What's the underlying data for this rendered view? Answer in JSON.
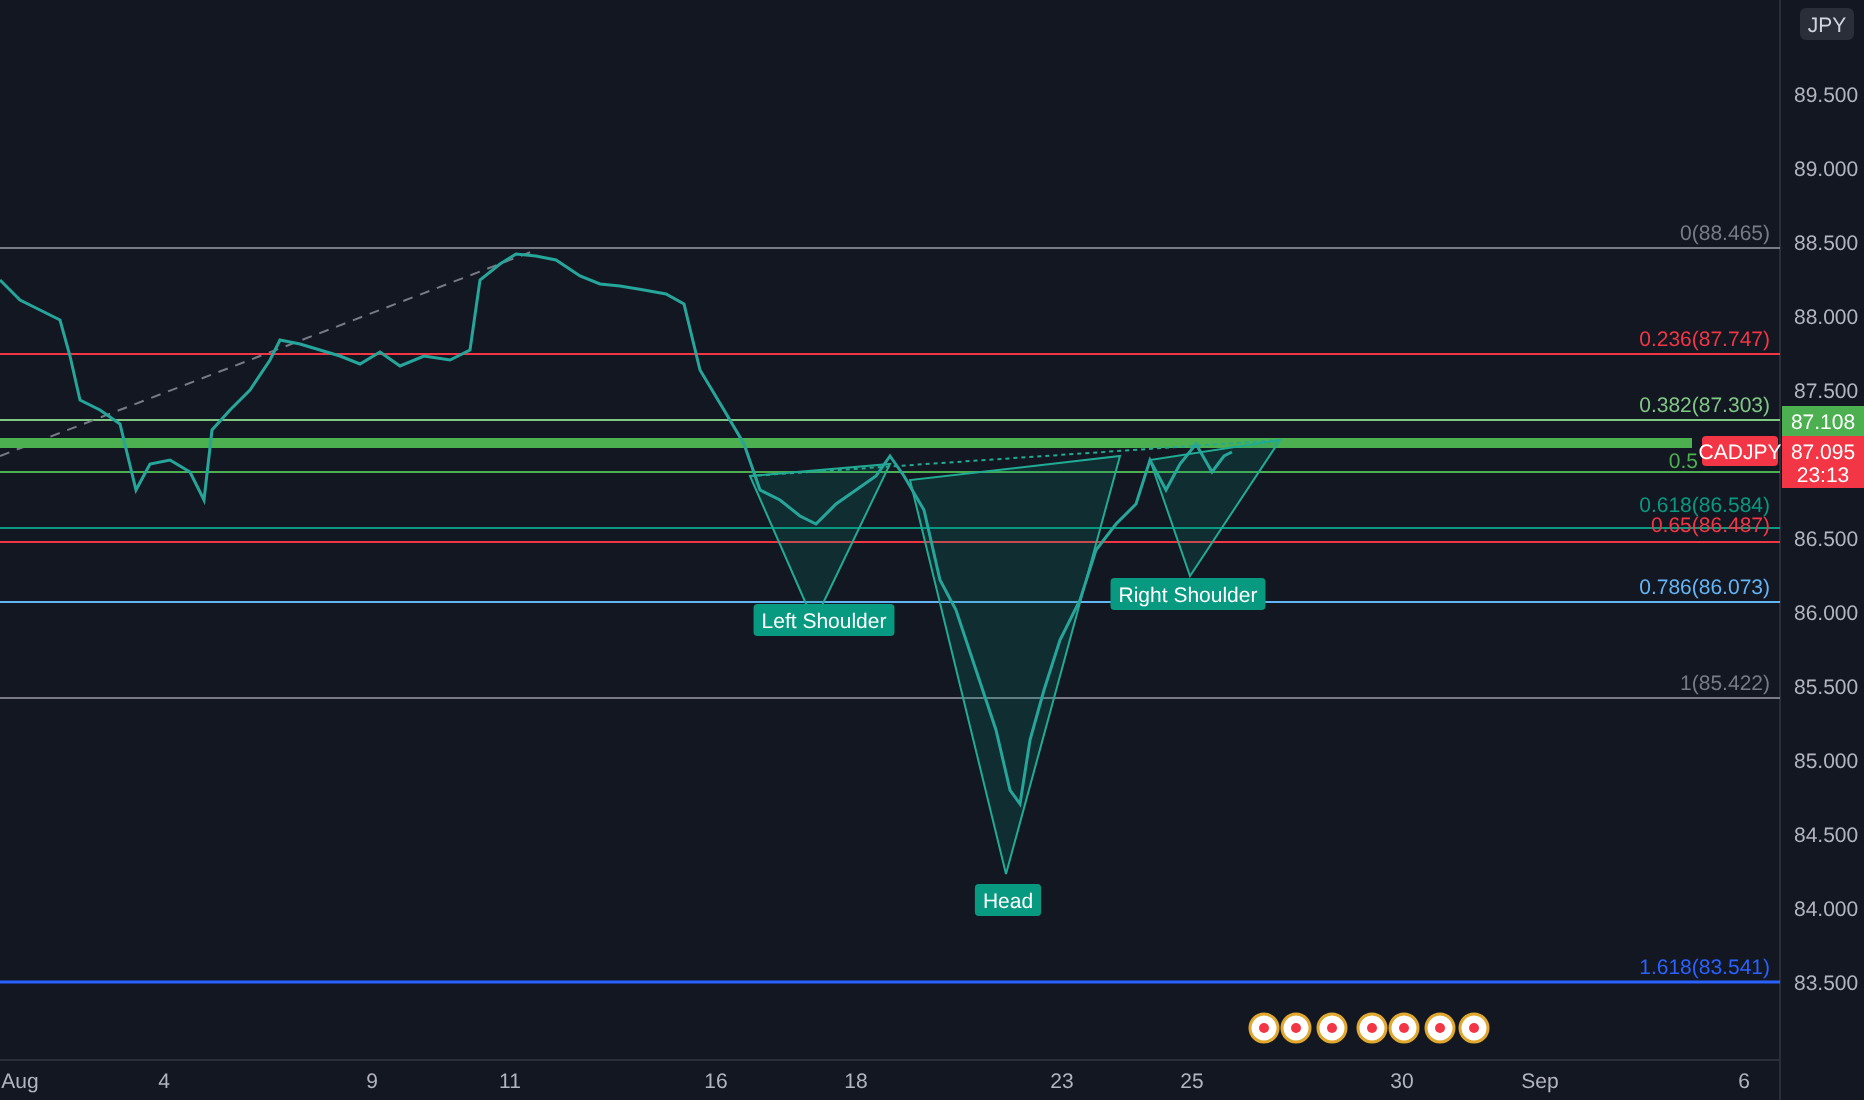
{
  "symbol_badge": "JPY",
  "price_axis": [
    "89.500",
    "89.000",
    "88.500",
    "88.000",
    "87.500",
    "86.500",
    "86.000",
    "85.500",
    "85.000",
    "84.500",
    "84.000",
    "83.500"
  ],
  "time_axis": [
    "Aug",
    "4",
    "9",
    "11",
    "16",
    "18",
    "23",
    "25",
    "30",
    "Sep",
    "6"
  ],
  "fib_levels": [
    {
      "label": "0(88.465)",
      "color": "#787b86"
    },
    {
      "label": "0.236(87.747)",
      "color": "#f23645"
    },
    {
      "label": "0.382(87.303)",
      "color": "#81c784"
    },
    {
      "label": "0.5",
      "color": "#4caf50"
    },
    {
      "label": "0.618(86.584)",
      "color": "#089981"
    },
    {
      "label": "0.65(86.487)",
      "color": "#f23645"
    },
    {
      "label": "0.786(86.073)",
      "color": "#64b5f6"
    },
    {
      "label": "1(85.422)",
      "color": "#787b86"
    },
    {
      "label": "1.618(83.541)",
      "color": "#2962ff"
    }
  ],
  "pattern_labels": [
    "Left Shoulder",
    "Head",
    "Right Shoulder"
  ],
  "symbol_tag": "CADJPY",
  "axis_tags": [
    {
      "text": "87.108",
      "color": "#4caf50"
    },
    {
      "text": "87.095",
      "color": "#f23645"
    }
  ],
  "countdown": "23:13"
}
